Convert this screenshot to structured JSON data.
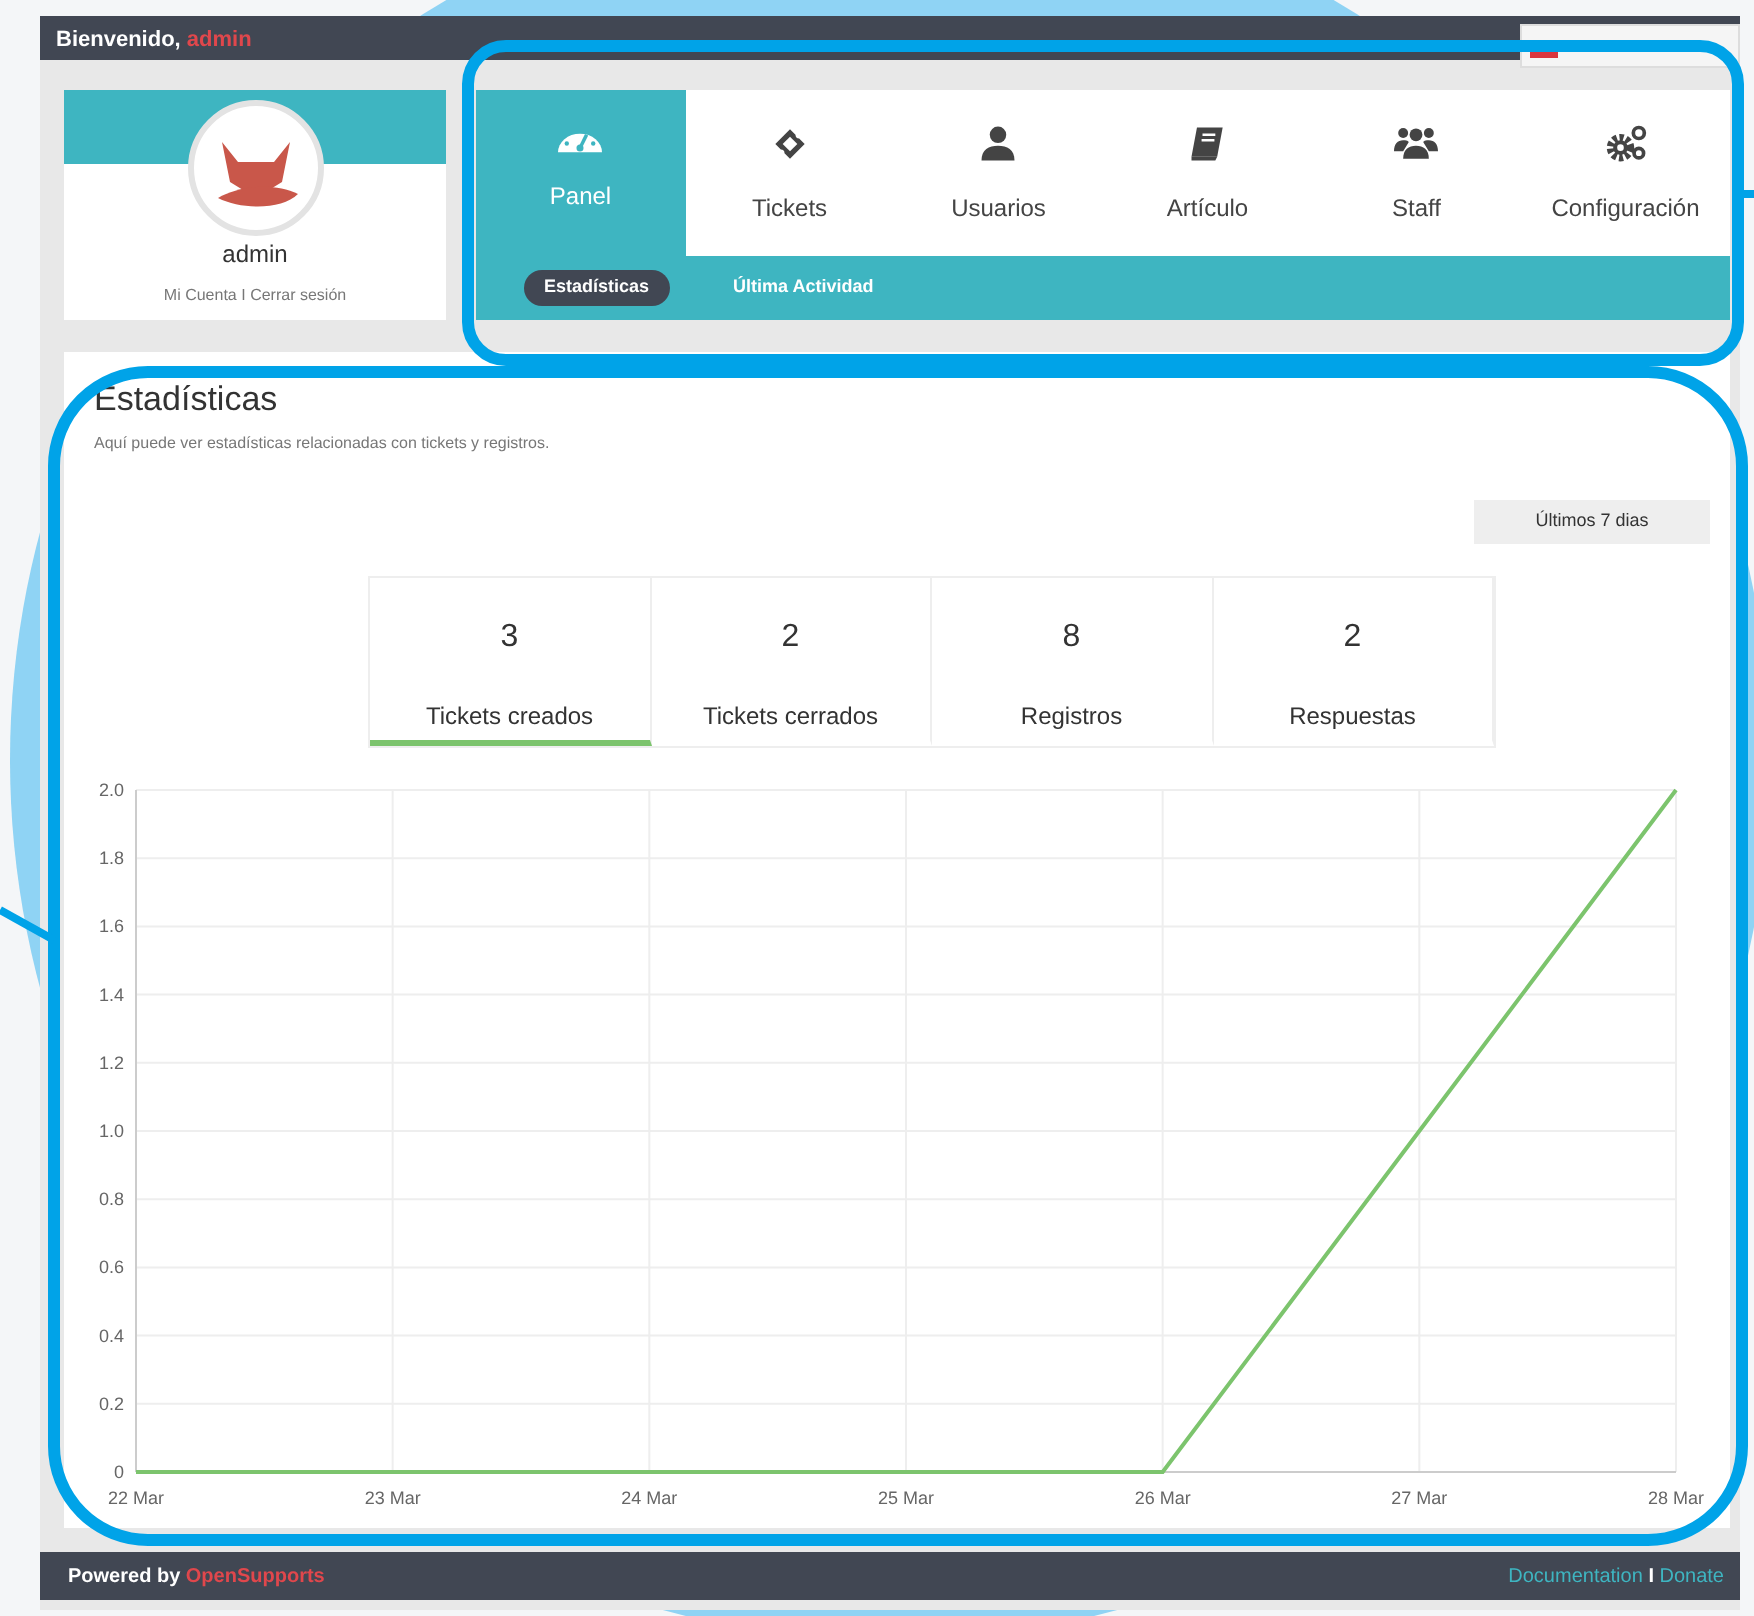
{
  "topbar": {
    "greeting": "Bienvenido,",
    "user": "admin"
  },
  "profile": {
    "name": "admin",
    "links": [
      "Mi Cuenta",
      "Cerrar sesión"
    ],
    "separator": "I"
  },
  "nav": {
    "tabs": [
      {
        "label": "Panel",
        "selected": true
      },
      {
        "label": "Tickets",
        "selected": false
      },
      {
        "label": "Usuarios",
        "selected": false
      },
      {
        "label": "Artículo",
        "selected": false
      },
      {
        "label": "Staff",
        "selected": false
      },
      {
        "label": "Configuración",
        "selected": false
      }
    ],
    "subtabs": [
      {
        "label": "Estadísticas",
        "selected": true
      },
      {
        "label": "Última Actividad",
        "selected": false
      }
    ]
  },
  "stats": {
    "title": "Estadísticas",
    "subtitle": "Aquí puede ver estadísticas relacionadas con tickets y registros.",
    "period_button": "Últimos 7 dias",
    "counters": [
      {
        "value": "3",
        "label": "Tickets creados",
        "selected": true
      },
      {
        "value": "2",
        "label": "Tickets cerrados",
        "selected": false
      },
      {
        "value": "8",
        "label": "Registros",
        "selected": false
      },
      {
        "value": "2",
        "label": "Respuestas",
        "selected": false
      }
    ],
    "chart_data": {
      "type": "line",
      "categories": [
        "22 Mar",
        "23 Mar",
        "24 Mar",
        "25 Mar",
        "26 Mar",
        "27 Mar",
        "28 Mar"
      ],
      "grid": true,
      "series": [
        {
          "color": "#7cc46d",
          "values": [
            0,
            0,
            0,
            0,
            0,
            1,
            2
          ]
        }
      ],
      "ylim": [
        0,
        2
      ],
      "yticks": [
        {
          "value": 0,
          "label": "0"
        },
        {
          "value": 0.2,
          "label": "0.2"
        },
        {
          "value": 0.4,
          "label": "0.4"
        },
        {
          "value": 0.6,
          "label": "0.6"
        },
        {
          "value": 0.8,
          "label": "0.8"
        },
        {
          "value": 1,
          "label": "1.0"
        },
        {
          "value": 1.2,
          "label": "1.2"
        },
        {
          "value": 1.4,
          "label": "1.4"
        },
        {
          "value": 1.6,
          "label": "1.6"
        },
        {
          "value": 1.8,
          "label": "1.8"
        },
        {
          "value": 2,
          "label": "2.0"
        }
      ]
    }
  },
  "footer": {
    "powered": "Powered by",
    "brand": "OpenSupports",
    "links": [
      "Documentation",
      "Donate"
    ],
    "separator": "I"
  }
}
